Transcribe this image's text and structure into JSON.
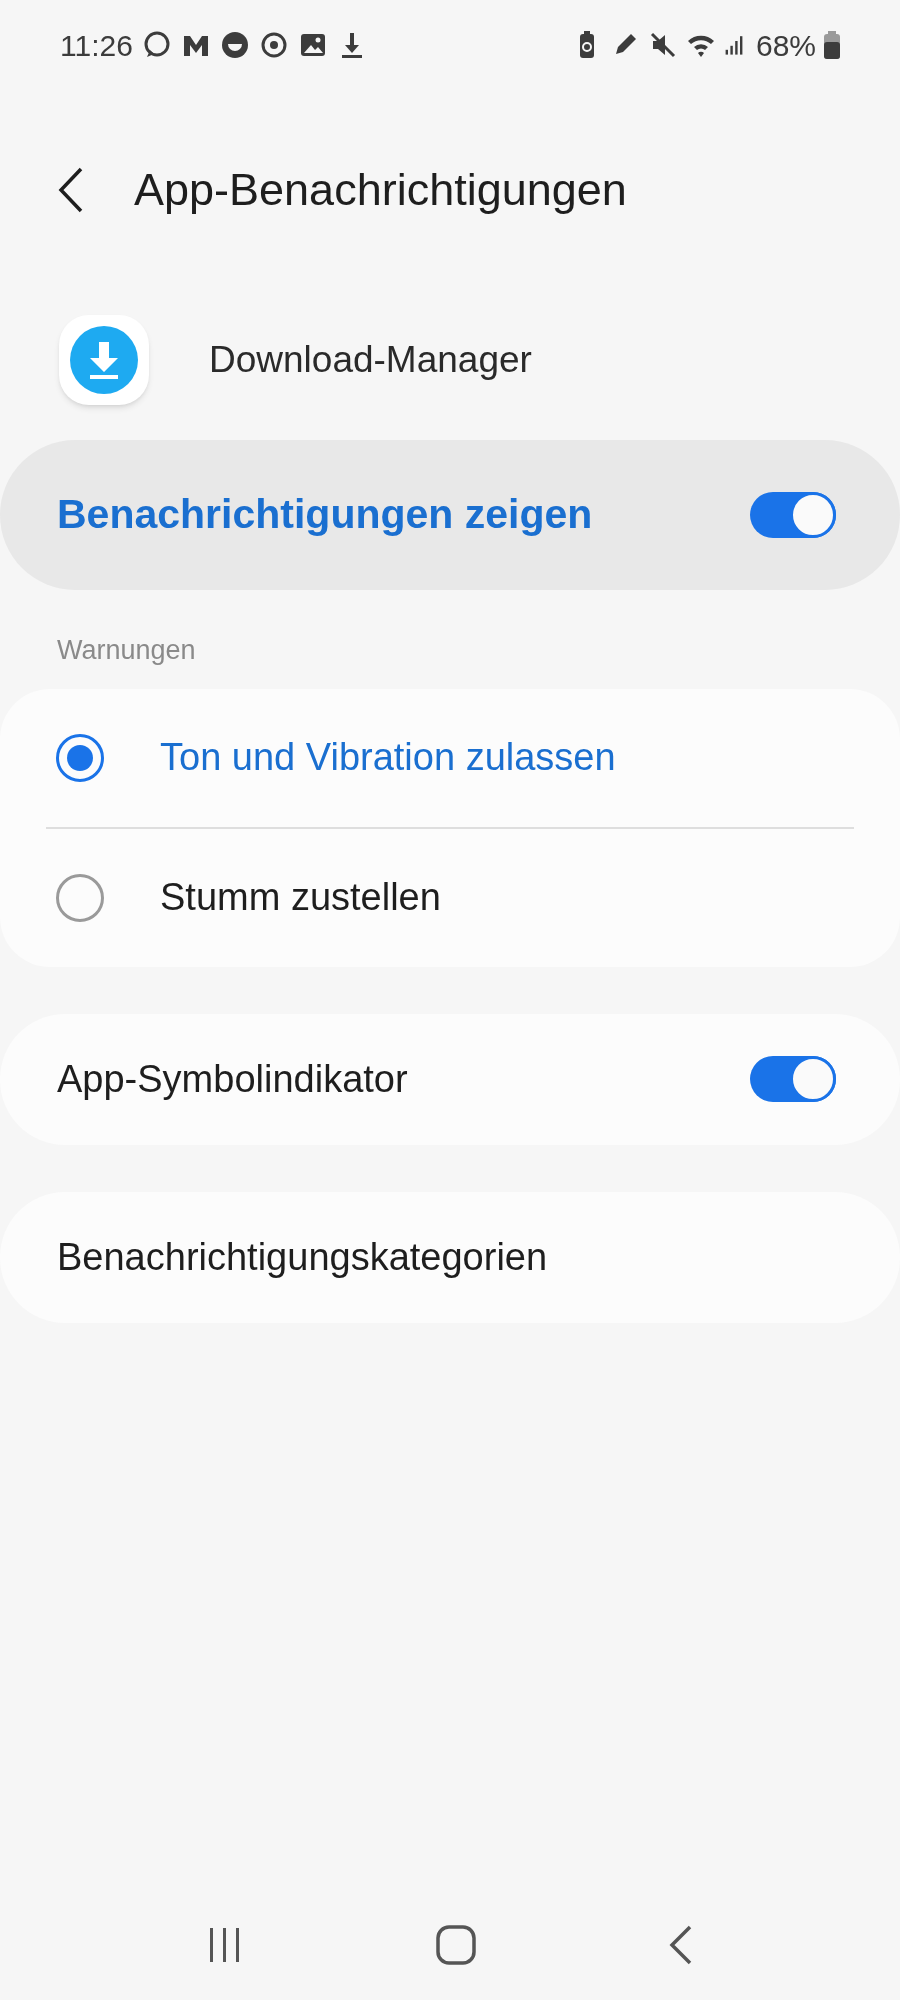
{
  "status_bar": {
    "time": "11:26",
    "battery": "68%"
  },
  "header": {
    "title": "App-Benachrichtigungen"
  },
  "app": {
    "name": "Download-Manager"
  },
  "main_switch": {
    "label": "Benachrichtigungen zeigen",
    "on": true
  },
  "alerts": {
    "heading": "Warnungen",
    "options": [
      {
        "label": "Ton und Vibration zulassen",
        "selected": true
      },
      {
        "label": "Stumm zustellen",
        "selected": false
      }
    ]
  },
  "settings": [
    {
      "kind": "toggle",
      "label": "App-Symbolindikator",
      "on": true
    },
    {
      "kind": "link",
      "label": "Benachrichtigungskategorien"
    }
  ]
}
